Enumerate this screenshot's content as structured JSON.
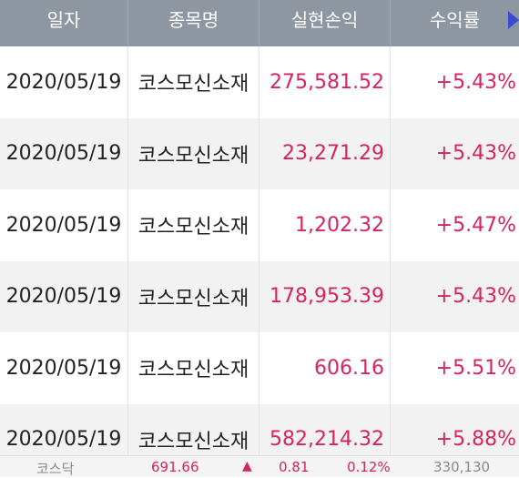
{
  "header": {
    "columns": [
      "일자",
      "종목명",
      "실현손익",
      "수익률"
    ]
  },
  "rows": [
    {
      "date": "2020/05/19",
      "name": "코스모신소재",
      "profit": "275,581.52",
      "rate": "+5.43%"
    },
    {
      "date": "2020/05/19",
      "name": "코스모신소재",
      "profit": "23,271.29",
      "rate": "+5.43%"
    },
    {
      "date": "2020/05/19",
      "name": "코스모신소재",
      "profit": "1,202.32",
      "rate": "+5.47%"
    },
    {
      "date": "2020/05/19",
      "name": "코스모신소재",
      "profit": "178,953.39",
      "rate": "+5.43%"
    },
    {
      "date": "2020/05/19",
      "name": "코스모신소재",
      "profit": "606.16",
      "rate": "+5.51%"
    },
    {
      "date": "2020/05/19",
      "name": "코스모신소재",
      "profit": "582,214.32",
      "rate": "+5.88%"
    }
  ],
  "ticker": {
    "label": "코스닥",
    "value": "691.66",
    "up_symbol": "▲",
    "change": "0.81",
    "rate": "0.12%",
    "volume": "330,130"
  },
  "colors": {
    "header_bg": "#8d96a1",
    "positive": "#d5245f",
    "alt_row": "#f2f2f2",
    "arrow": "#3a4ad6"
  }
}
